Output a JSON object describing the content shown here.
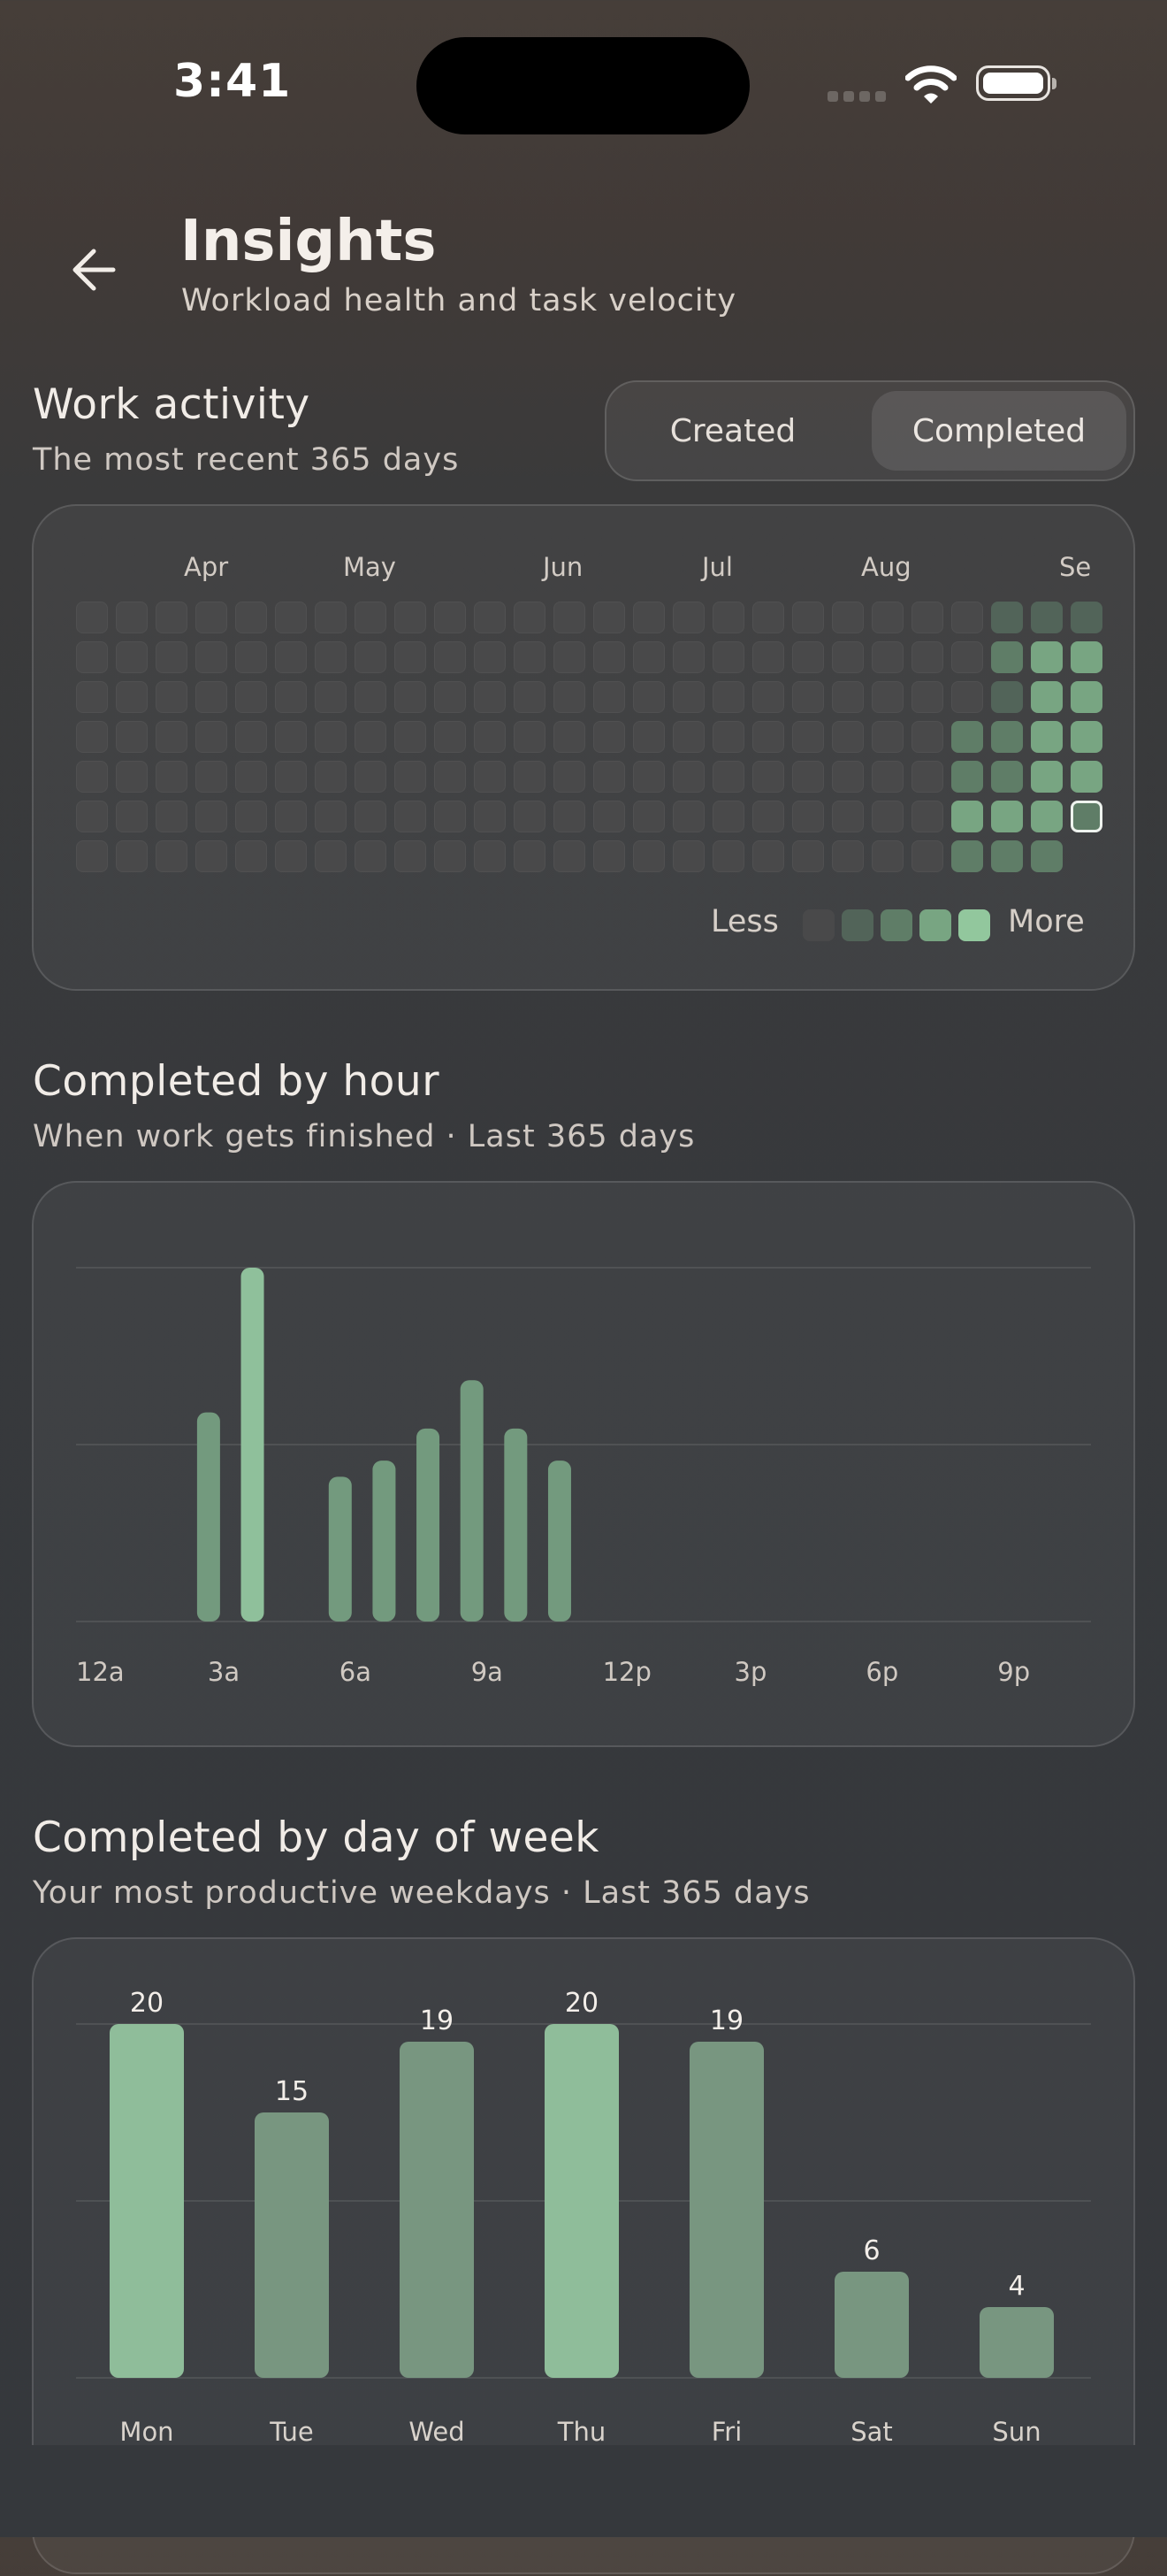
{
  "status_bar": {
    "time": "3:41"
  },
  "header": {
    "title": "Insights",
    "subtitle": "Workload health and task velocity",
    "back_icon": "arrow-left-icon"
  },
  "work_activity": {
    "title": "Work activity",
    "subtitle": "The most recent 365 days",
    "toggle": {
      "options": [
        "Created",
        "Completed"
      ],
      "selected": "Completed"
    },
    "months": [
      "Apr",
      "May",
      "Jun",
      "Jul",
      "Aug",
      "Se"
    ],
    "legend": {
      "less": "Less",
      "more": "More"
    },
    "level_colors": [
      "#49494a",
      "#526459",
      "#5f7d67",
      "#78a582",
      "#92c79d"
    ]
  },
  "completed_by_hour": {
    "title": "Completed by hour",
    "subtitle": "When work gets finished · Last 365 days"
  },
  "completed_by_day": {
    "title": "Completed by day of week",
    "subtitle": "Your most productive weekdays · Last 365 days"
  },
  "chart_data": [
    {
      "type": "bar",
      "title": "Completed by hour",
      "x": [
        3,
        4,
        6,
        7,
        8,
        9,
        10,
        11
      ],
      "values": [
        13,
        22,
        9,
        10,
        12,
        15,
        12,
        10
      ],
      "x_tick_labels": [
        "12a",
        "3a",
        "6a",
        "9a",
        "12p",
        "3p",
        "6p",
        "9p"
      ],
      "xlim": [
        0,
        24
      ],
      "ylim": [
        0,
        22
      ],
      "grid": true
    },
    {
      "type": "bar",
      "title": "Completed by day of week",
      "categories": [
        "Mon",
        "Tue",
        "Wed",
        "Thu",
        "Fri",
        "Sat",
        "Sun"
      ],
      "values": [
        20,
        15,
        19,
        20,
        19,
        6,
        4
      ],
      "ylim": [
        0,
        20
      ],
      "grid": true
    }
  ]
}
